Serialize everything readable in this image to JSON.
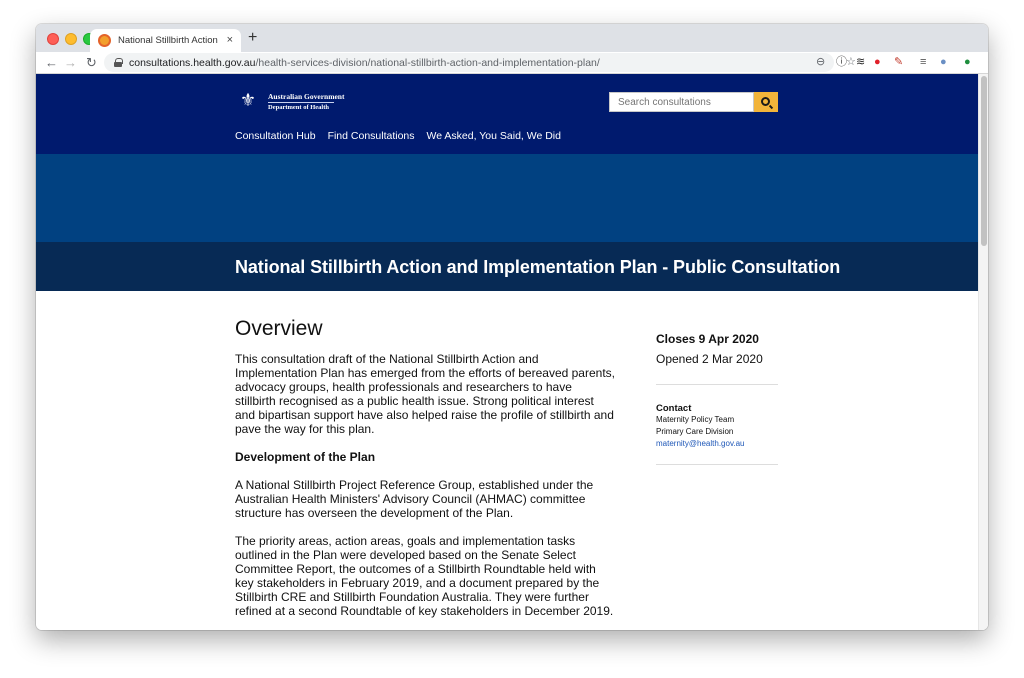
{
  "browser": {
    "tab_title": "National Stillbirth Action and Implementation Plan",
    "tab_close": "×",
    "new_tab": "+",
    "url_domain": "consultations.health.gov.au",
    "url_path": "/health-services-division/national-stillbirth-action-and-implementation-plan/",
    "nav_back": "←",
    "nav_forward": "→",
    "nav_reload": "↻"
  },
  "site": {
    "logo_line1": "Australian Government",
    "logo_line2": "Department of Health",
    "search_placeholder": "Search consultations",
    "nav": [
      "Consultation Hub",
      "Find Consultations",
      "We Asked, You Said, We Did"
    ],
    "page_title": "National Stillbirth Action and Implementation Plan - Public Consultation"
  },
  "main": {
    "heading": "Overview",
    "para1": "This consultation draft of the National Stillbirth Action and Implementation Plan has emerged from the efforts of bereaved parents, advocacy groups, health professionals and researchers to have stillbirth recognised as a public health issue. Strong political interest and bipartisan support have also helped raise the profile of stillbirth and pave the way for this plan.",
    "subheading": "Development of the Plan",
    "para2": "A National Stillbirth Project Reference Group, established under the Australian Health Ministers' Advisory Council (AHMAC) committee structure has overseen the development of the Plan.",
    "para3": "The priority areas, action areas, goals and implementation tasks outlined in the Plan were developed based on the Senate Select Committee Report, the outcomes of a Stillbirth Roundtable held with key stakeholders in February 2019, and a document prepared by the Stillbirth CRE and Stillbirth Foundation Australia. They were further refined at a second Roundtable of key stakeholders in December 2019."
  },
  "sidebar": {
    "closes": "Closes 9 Apr 2020",
    "opened": "Opened 2 Mar 2020",
    "contact_heading": "Contact",
    "contact_team": "Maternity Policy Team",
    "contact_division": "Primary Care Division",
    "contact_email": "maternity@health.gov.au"
  },
  "colors": {
    "header_bg": "#001a6e",
    "banner_bg": "#014181",
    "title_bg": "#072a55",
    "search_button": "#f2b43a",
    "link": "#1f58b8"
  },
  "icons": [
    "search-icon",
    "lock-icon",
    "zoom-icon",
    "star-icon",
    "extension-icons",
    "crest-icon"
  ]
}
